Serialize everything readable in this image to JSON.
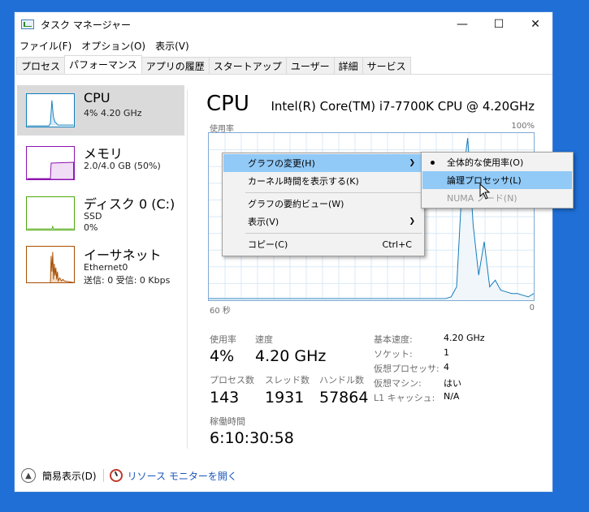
{
  "window": {
    "title": "タスク マネージャー",
    "min": "—",
    "max": "☐",
    "close": "✕"
  },
  "menu": [
    "ファイル(F)",
    "オプション(O)",
    "表示(V)"
  ],
  "tabs": [
    "プロセス",
    "パフォーマンス",
    "アプリの履歴",
    "スタートアップ",
    "ユーザー",
    "詳細",
    "サービス"
  ],
  "sidebar": [
    {
      "title": "CPU",
      "line1": "4% 4.20 GHz",
      "line2": "",
      "line3": "",
      "color": "#117dbb"
    },
    {
      "title": "メモリ",
      "line1": "2.0/4.0 GB (50%)",
      "line2": "",
      "line3": "",
      "color": "#8b12ae"
    },
    {
      "title": "ディスク 0 (C:)",
      "line1": "SSD",
      "line2": "0%",
      "line3": "",
      "color": "#4da60c"
    },
    {
      "title": "イーサネット",
      "line1": "Ethernet0",
      "line2": "送信: 0 受信: 0 Kbps",
      "line3": "",
      "color": "#a74f01"
    }
  ],
  "main": {
    "title": "CPU",
    "model": "Intel(R) Core(TM) i7-7700K CPU @ 4.20GHz",
    "graph_label": "使用率",
    "graph_max": "100%",
    "time_left": "60 秒",
    "time_right": "0",
    "usage_values": [
      1,
      1,
      1,
      1,
      1,
      1,
      1,
      1,
      1,
      1,
      1,
      1,
      1,
      1,
      1,
      1,
      1,
      1,
      1,
      1,
      1,
      1,
      1,
      1,
      1,
      1,
      1,
      1,
      1,
      1,
      1,
      1,
      1,
      1,
      1,
      1,
      1,
      1,
      1,
      1,
      1,
      1,
      1,
      1,
      2,
      8,
      70,
      97,
      45,
      15,
      35,
      8,
      12,
      6,
      5,
      4,
      4,
      3,
      2,
      4
    ],
    "stats": {
      "usage_label": "使用率",
      "usage": "4%",
      "speed_label": "速度",
      "speed": "4.20 GHz",
      "proc_label": "プロセス数",
      "proc": "143",
      "threads_label": "スレッド数",
      "threads": "1931",
      "handles_label": "ハンドル数",
      "handles": "57864",
      "uptime_label": "稼働時間",
      "uptime": "6:10:30:58"
    },
    "details": [
      {
        "k": "基本速度:",
        "v": "4.20 GHz"
      },
      {
        "k": "ソケット:",
        "v": "1"
      },
      {
        "k": "仮想プロセッサ:",
        "v": "4"
      },
      {
        "k": "仮想マシン:",
        "v": "はい"
      },
      {
        "k": "L1 キャッシュ:",
        "v": "N/A"
      }
    ]
  },
  "bottom": {
    "less": "簡易表示(D)",
    "resmon": "リソース モニターを開く"
  },
  "context_menu": {
    "items": [
      {
        "label": "グラフの変更(H)",
        "submenu": true
      },
      {
        "label": "カーネル時間を表示する(K)"
      },
      {
        "label": "グラフの要約ビュー(W)"
      },
      {
        "label": "表示(V)",
        "submenu": true
      },
      {
        "label": "コピー(C)",
        "shortcut": "Ctrl+C"
      }
    ],
    "submenu": [
      {
        "label": "全体的な使用率(O)",
        "checked": true
      },
      {
        "label": "論理プロセッサ(L)"
      },
      {
        "label": "NUMA ノード(N)",
        "disabled": true
      }
    ]
  }
}
